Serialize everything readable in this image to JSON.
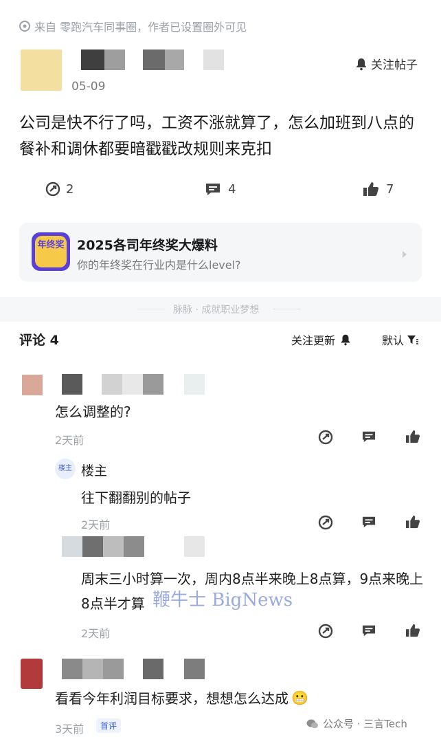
{
  "post": {
    "source_line": "来自 零跑汽车同事圈，作者已设置圈外可见",
    "date": "05-09",
    "follow_post": "关注帖子",
    "content": "公司是快不行了吗，工资不涨就算了，怎么加班到八点的餐补和调休都要暗戳戳改规则来克扣",
    "actions": {
      "share_count": "2",
      "comment_count": "4",
      "like_count": "7"
    }
  },
  "topic": {
    "badge_text": "年终奖",
    "title": "2025各司年终奖大爆料",
    "subtitle": "你的年终奖在行业内是什么level?"
  },
  "divider_text": "脉脉 · 成就职业梦想",
  "comments_header": {
    "title": "评论 4",
    "follow_updates": "关注更新",
    "sort": "默认"
  },
  "comments": [
    {
      "text": "怎么调整的?",
      "time": "2天前"
    },
    {
      "author": "楼主",
      "owner_badge": "楼主",
      "text": "往下翻翻别的帖子",
      "time": "2天前",
      "nested": true
    },
    {
      "text": "周末三小时算一次，周内8点半来晚上8点算，9点来晚上8点半才算",
      "time": "2天前",
      "nested": true
    },
    {
      "text": "看看今年利润目标要求，想想怎么达成",
      "emoji": "😬",
      "time": "3天前",
      "tag": "首评"
    }
  ],
  "watermarks": {
    "bignews": "鞭牛士 BigNews",
    "wechat": "公众号 · 三言Tech"
  },
  "colors": {
    "accent": "#3a62d7",
    "muted": "#9aa0a6",
    "card": "#f5f6f8",
    "topic_purple": "#5b3fd9",
    "topic_yellow": "#f7c948"
  }
}
